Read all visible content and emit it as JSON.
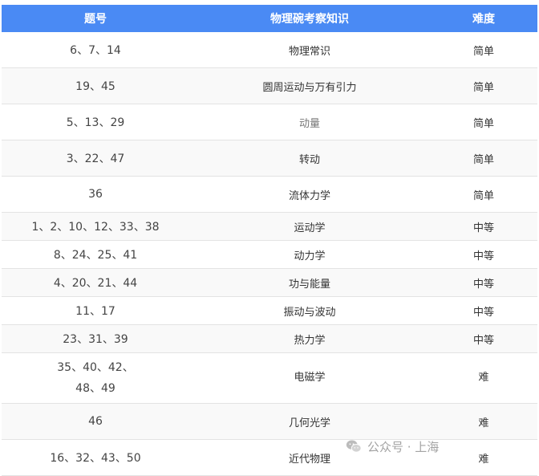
{
  "header": {
    "col_numbers": "题号",
    "col_topic": "物理碗考察知识",
    "col_difficulty": "难度"
  },
  "rows": [
    {
      "numbers": "6、7、14",
      "topic": "物理常识",
      "difficulty": "简单"
    },
    {
      "numbers": "19、45",
      "topic": "圆周运动与万有引力",
      "difficulty": "简单"
    },
    {
      "numbers": "5、13、29",
      "topic": "动量",
      "difficulty": "简单"
    },
    {
      "numbers": "3、22、47",
      "topic": "转动",
      "difficulty": "简单"
    },
    {
      "numbers": "36",
      "topic": "流体力学",
      "difficulty": "简单"
    },
    {
      "numbers": "1、2、10、12、33、38",
      "topic": "运动学",
      "difficulty": "中等"
    },
    {
      "numbers": "8、24、25、41",
      "topic": "动力学",
      "difficulty": "中等"
    },
    {
      "numbers": "4、20、21、44",
      "topic": "功与能量",
      "difficulty": "中等"
    },
    {
      "numbers": "11、17",
      "topic": "振动与波动",
      "difficulty": "中等"
    },
    {
      "numbers": "23、31、39",
      "topic": "热力学",
      "difficulty": "中等"
    },
    {
      "numbers_line1": "35、40、42、",
      "numbers_line2": "48、49",
      "topic": "电磁学",
      "difficulty": "难"
    },
    {
      "numbers": "46",
      "topic": "几何光学",
      "difficulty": "难"
    },
    {
      "numbers": "16、32、43、50",
      "topic": "近代物理",
      "difficulty": "难"
    }
  ],
  "watermark": {
    "text": "公众号 · 上海",
    "logo_icon": "wechat-icon"
  },
  "colors": {
    "header_bg": "#4a8af4",
    "header_text": "#ffffff"
  }
}
